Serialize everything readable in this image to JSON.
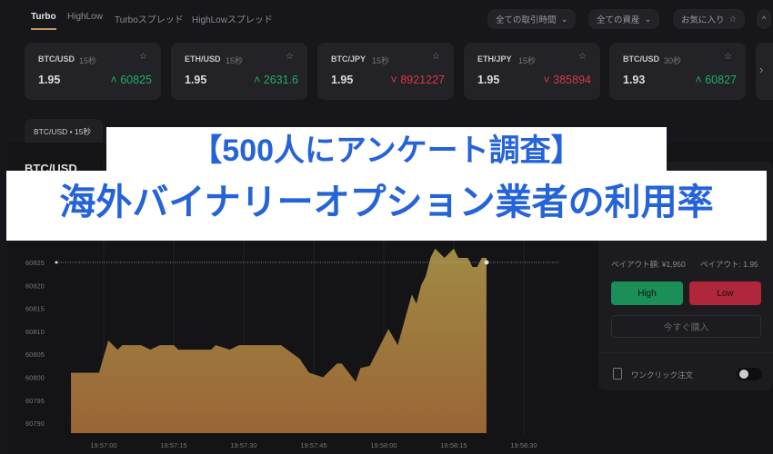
{
  "tabs": [
    {
      "label": "Turbo",
      "active": true
    },
    {
      "label": "HighLow"
    },
    {
      "label": "Turboスプレッド"
    },
    {
      "label": "HighLowスプレッド"
    }
  ],
  "filters": {
    "period": "全ての取引時間",
    "assets": "全ての資産",
    "favorites": "お気に入り"
  },
  "cards": [
    {
      "pair": "BTC/USD",
      "duration": "15秒",
      "payout": "1.95",
      "price": "60825",
      "direction": "up"
    },
    {
      "pair": "ETH/USD",
      "duration": "15秒",
      "payout": "1.95",
      "price": "2631.6",
      "direction": "up"
    },
    {
      "pair": "BTC/JPY",
      "duration": "15秒",
      "payout": "1.95",
      "price": "8921227",
      "direction": "down"
    },
    {
      "pair": "ETH/JPY",
      "duration": "15秒",
      "payout": "1.95",
      "price": "385894",
      "direction": "down"
    },
    {
      "pair": "BTC/USD",
      "duration": "30秒",
      "payout": "1.93",
      "price": "60827",
      "direction": "up"
    }
  ],
  "chart_tab": "BTC/USD • 15秒",
  "chart_title": "BTC/USD",
  "banner": {
    "line1": "【500人にアンケート調査】",
    "line2": "海外バイナリーオプション業者の利用率"
  },
  "trade": {
    "payout_amount": "ペイアウト額: ¥1,950",
    "payout_rate": "ペイアウト: 1.95",
    "high": "High",
    "low": "Low",
    "buy_now": "今すぐ購入",
    "one_click": "ワンクリック注文",
    "one_click_on": false
  },
  "colors": {
    "up": "#1fae66",
    "down": "#d43a4a",
    "high_btn": "#1a8f57",
    "low_btn": "#b0263a",
    "area_top": "#a08a45",
    "area_bottom": "#9a6535",
    "banner_text": "#2563d9"
  },
  "chart_data": {
    "type": "area",
    "yticks": [
      "60825",
      "60820",
      "60815",
      "60810",
      "60805",
      "60800",
      "60795",
      "60790"
    ],
    "xticks": [
      "19:57:00",
      "19:57:15",
      "19:57:30",
      "19:57:45",
      "19:58:00",
      "19:58:15",
      "19:58:30"
    ],
    "current_price": 60825,
    "points": [
      [
        "19:56:53",
        60801
      ],
      [
        "19:56:59",
        60801
      ],
      [
        "19:57:01",
        60808
      ],
      [
        "19:57:03",
        60806
      ],
      [
        "19:57:04",
        60807
      ],
      [
        "19:57:08",
        60807
      ],
      [
        "19:57:10",
        60806
      ],
      [
        "19:57:12",
        60807
      ],
      [
        "19:57:15",
        60807
      ],
      [
        "19:57:16",
        60806
      ],
      [
        "19:57:23",
        60806
      ],
      [
        "19:57:24",
        60807
      ],
      [
        "19:57:27",
        60806
      ],
      [
        "19:57:29",
        60807
      ],
      [
        "19:57:38",
        60807
      ],
      [
        "19:57:42",
        60804
      ],
      [
        "19:57:44",
        60801
      ],
      [
        "19:57:47",
        60800
      ],
      [
        "19:57:50",
        60803
      ],
      [
        "19:57:51",
        60803
      ],
      [
        "19:57:54",
        60799
      ],
      [
        "19:57:55",
        60802
      ],
      [
        "19:57:57",
        60802.5
      ],
      [
        "19:58:01",
        60810.5
      ],
      [
        "19:58:03",
        60807
      ],
      [
        "19:58:06",
        60818
      ],
      [
        "19:58:07",
        60816
      ],
      [
        "19:58:08",
        60820
      ],
      [
        "19:58:09",
        60822
      ],
      [
        "19:58:10",
        60826
      ],
      [
        "19:58:11",
        60828
      ],
      [
        "19:58:13",
        60826
      ],
      [
        "19:58:15",
        60828
      ],
      [
        "19:58:16",
        60826
      ],
      [
        "19:58:18",
        60826
      ],
      [
        "19:58:19",
        60824
      ],
      [
        "19:58:20",
        60824
      ],
      [
        "19:58:21",
        60826
      ],
      [
        "19:58:22",
        60826
      ]
    ]
  }
}
